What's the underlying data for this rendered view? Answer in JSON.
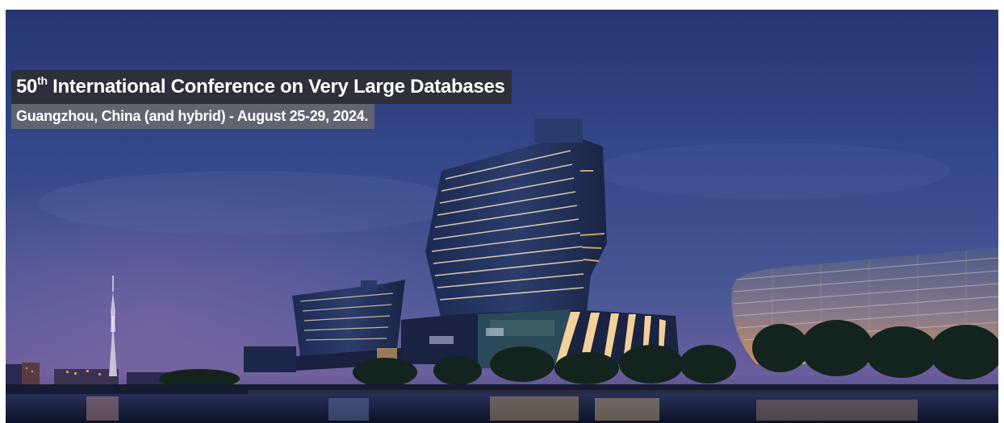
{
  "banner": {
    "title_ordinal": "50",
    "title_ordinal_suffix": "th",
    "title_rest": " International Conference on Very Large Databases",
    "subtitle": "Guangzhou, China (and hybrid) - August 25-29, 2024.",
    "colors": {
      "sky_top": "#2a3876",
      "sky_mid": "#3b4c8c",
      "horizon": "#6b5a98",
      "water": "#141c3a",
      "building_light": "#f3c27a",
      "title_bg": "#2e2e32",
      "subtitle_bg": "#69696e"
    }
  }
}
